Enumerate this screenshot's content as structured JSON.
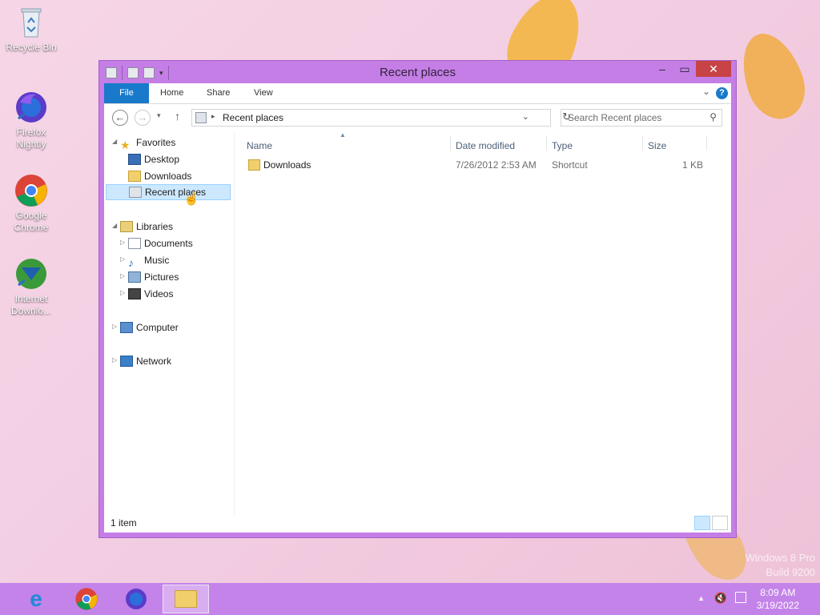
{
  "desktop": {
    "icons": [
      {
        "label": "Recycle Bin"
      },
      {
        "label": "Firefox Nightly"
      },
      {
        "label": "Google Chrome"
      },
      {
        "label": "Internet Downlo..."
      }
    ],
    "watermark": {
      "line1": "Windows 8 Pro",
      "line2": "Build 9200"
    }
  },
  "window": {
    "title": "Recent places",
    "ribbon_tabs": [
      "File",
      "Home",
      "Share",
      "View"
    ],
    "address": "Recent places",
    "search_placeholder": "Search Recent places",
    "nav": {
      "favorites": "Favorites",
      "favorites_items": [
        "Desktop",
        "Downloads",
        "Recent places"
      ],
      "libraries": "Libraries",
      "libraries_items": [
        "Documents",
        "Music",
        "Pictures",
        "Videos"
      ],
      "computer": "Computer",
      "network": "Network"
    },
    "columns": [
      "Name",
      "Date modified",
      "Type",
      "Size"
    ],
    "files": [
      {
        "name": "Downloads",
        "date": "7/26/2012 2:53 AM",
        "type": "Shortcut",
        "size": "1 KB"
      }
    ],
    "status": "1 item"
  },
  "taskbar": {
    "time": "8:09 AM",
    "date": "3/19/2022"
  },
  "colors": {
    "accent": "#c383e8",
    "file_tab": "#1979ca",
    "close": "#c74346",
    "selection": "#cce8ff"
  }
}
